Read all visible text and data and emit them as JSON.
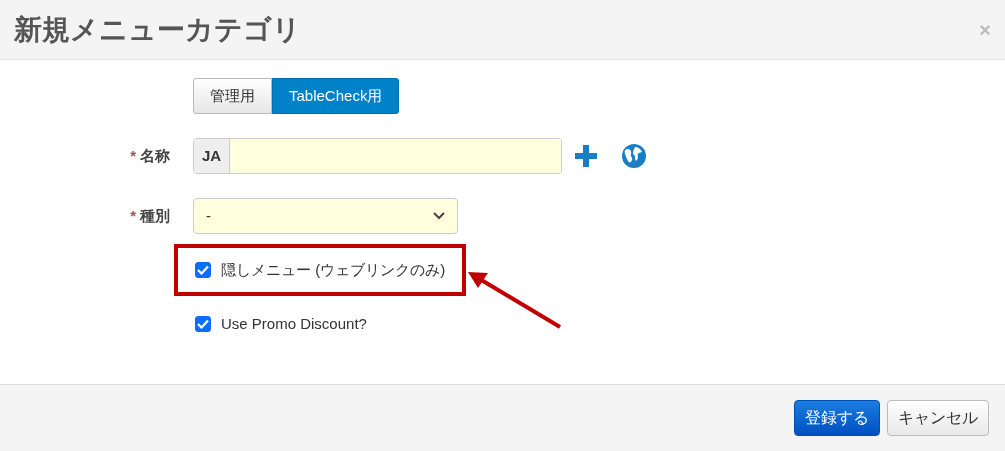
{
  "dialog": {
    "title": "新規メニューカテゴリ",
    "close": "×"
  },
  "scope_toggle": [
    {
      "label": "管理用",
      "selected": false
    },
    {
      "label": "TableCheck用",
      "selected": true
    }
  ],
  "fields": [
    {
      "kind": "text",
      "label": "名称",
      "required_mark": "*",
      "prefix": "JA"
    },
    {
      "kind": "select",
      "label": "種別",
      "required_mark": "*",
      "value": "-"
    }
  ],
  "checkboxes": [
    {
      "label": "隠しメニュー (ウェブリンクのみ)",
      "checked": true,
      "highlighted": true
    },
    {
      "label": "Use Promo Discount?",
      "checked": true,
      "highlighted": false
    }
  ],
  "buttons": [
    {
      "label": "登録する",
      "kind": "primary"
    },
    {
      "label": "キャンセル",
      "kind": "secondary"
    }
  ]
}
